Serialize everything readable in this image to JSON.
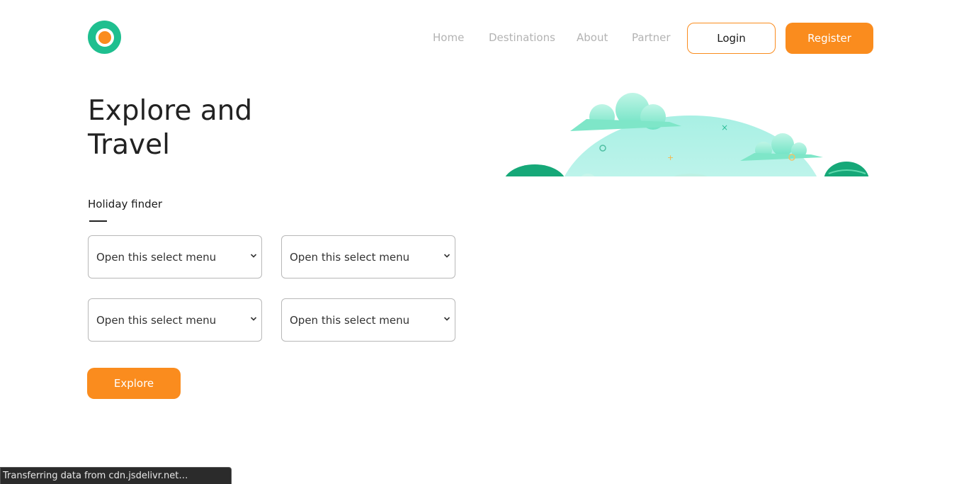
{
  "header": {
    "logo_icon": "logo-ring-icon",
    "nav": [
      {
        "label": "Home"
      },
      {
        "label": "Destinations"
      },
      {
        "label": "About"
      },
      {
        "label": "Partner"
      }
    ],
    "login_label": "Login",
    "register_label": "Register"
  },
  "hero": {
    "title_line1": "Explore and",
    "title_line2": "Travel",
    "finder_label": "Holiday finder",
    "selects": [
      {
        "value": "Open this select menu"
      },
      {
        "value": "Open this select menu"
      },
      {
        "value": "Open this select menu"
      },
      {
        "value": "Open this select menu"
      }
    ],
    "explore_label": "Explore"
  },
  "status_bar": {
    "text": "Transferring data from cdn.jsdelivr.net…"
  },
  "colors": {
    "accent": "#fa8c1e",
    "brand_green": "#1fbf8f",
    "nav_text": "#b3b3b3"
  }
}
